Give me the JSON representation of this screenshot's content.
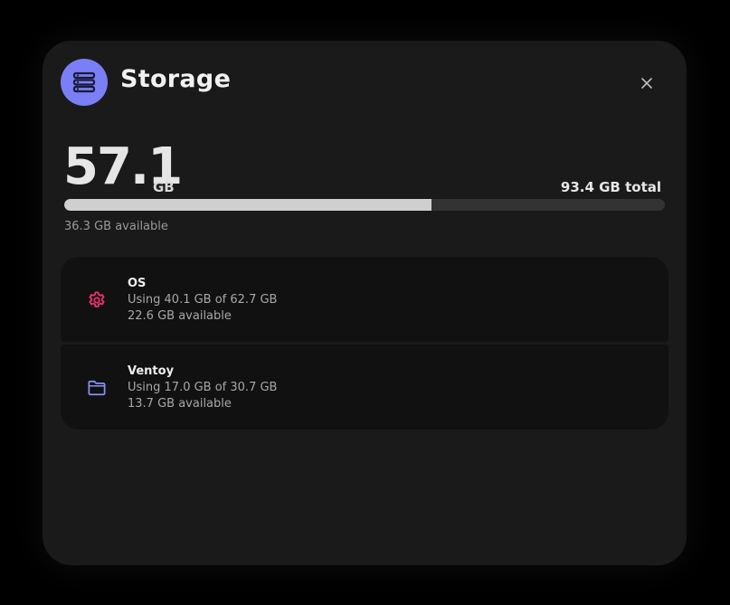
{
  "header": {
    "title": "Storage",
    "icon": "storage-server-icon",
    "icon_bg": "#7b7ff5",
    "close_icon": "close-icon"
  },
  "summary": {
    "used_value": "57.1",
    "used_unit": "GB",
    "total_text": "93.4 GB total",
    "available_text": "36.3 GB available",
    "used_fraction": 0.611
  },
  "drives": [
    {
      "name": "OS",
      "usage": "Using 40.1 GB of 62.7 GB",
      "available": "22.6 GB available",
      "icon": "gear-icon",
      "icon_color": "#e8336b"
    },
    {
      "name": "Ventoy",
      "usage": "Using 17.0 GB of 30.7 GB",
      "available": "13.7 GB available",
      "icon": "folder-icon",
      "icon_color": "#8b8ff7"
    }
  ],
  "colors": {
    "panel_bg": "#1a1a1a",
    "item_bg": "#111111",
    "bar_fill": "#cfcfcf",
    "bar_track": "#333333"
  }
}
